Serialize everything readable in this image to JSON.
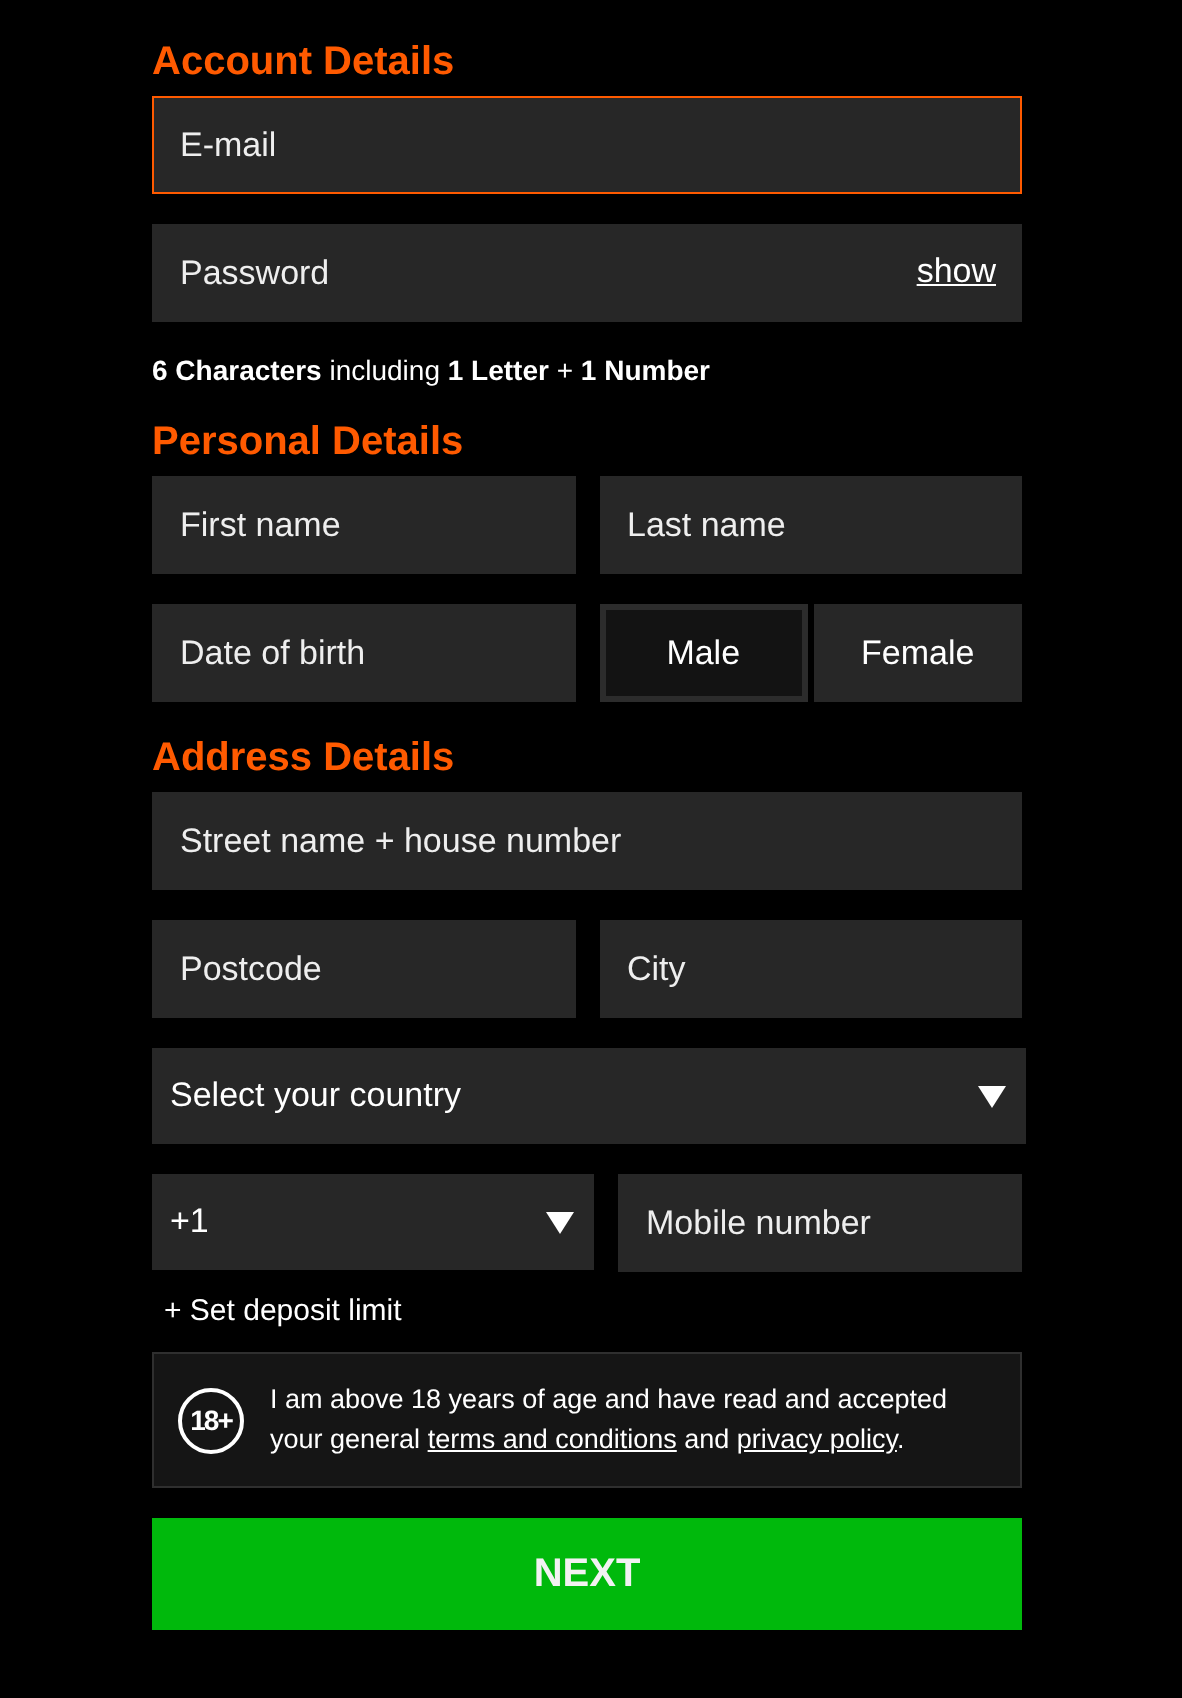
{
  "sections": [
    {
      "title": "Account Details",
      "rows": [
        [
          {
            "kind": "input",
            "placeholder": "E-mail",
            "focused": true
          }
        ],
        [
          {
            "kind": "password",
            "placeholder": "Password",
            "toggle": "show",
            "focused": false
          }
        ]
      ],
      "hint": "**6 Characters** including **1 Letter** + **1 Number**"
    },
    {
      "title": "Personal Details",
      "rows": [
        [
          {
            "kind": "input",
            "placeholder": "First name",
            "focused": false
          },
          {
            "kind": "input",
            "placeholder": "Last name",
            "focused": false
          }
        ],
        [
          {
            "kind": "input",
            "placeholder": "Date of birth",
            "focused": false
          },
          {
            "kind": "segmented",
            "options": [
              {
                "label": "Male",
                "selected": true
              },
              {
                "label": "Female",
                "selected": false
              }
            ]
          }
        ]
      ]
    },
    {
      "title": "Address Details",
      "rows": [
        [
          {
            "kind": "input",
            "placeholder": "Street name + house number",
            "focused": false
          }
        ],
        [
          {
            "kind": "input",
            "placeholder": "Postcode",
            "focused": false
          },
          {
            "kind": "input",
            "placeholder": "City",
            "focused": false
          }
        ],
        [
          {
            "kind": "select",
            "value": "Select your country"
          }
        ],
        [
          {
            "kind": "select",
            "value": "+1"
          },
          {
            "kind": "input",
            "placeholder": "Mobile number",
            "focused": false
          }
        ]
      ]
    }
  ],
  "deposit_link": "+ Set deposit limit",
  "consent": {
    "badge": "18+",
    "before": "I am above 18 years of age and have read and accepted your general ",
    "terms_link": "terms and conditions",
    "middle": " and ",
    "privacy_link": "privacy policy",
    "after": "."
  },
  "next_button": "NEXT"
}
